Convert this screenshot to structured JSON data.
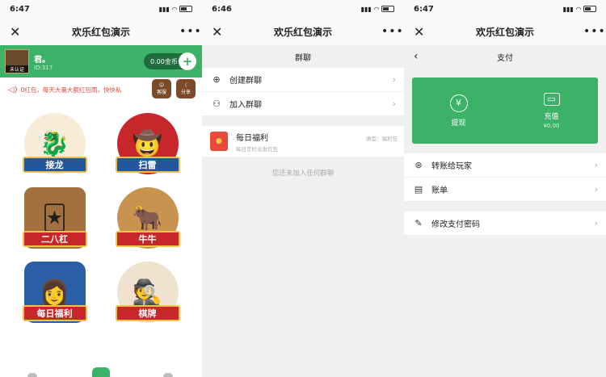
{
  "screen1": {
    "time": "6:47",
    "title": "欢乐红包演示",
    "user": {
      "name": "君。",
      "id": "ID:317",
      "avatar_tag": "未认证"
    },
    "coins": "0.00金币",
    "notice": "0红包，每天大量大额红包雨，快快私",
    "notice_buttons": [
      "客服",
      "分享"
    ],
    "games": [
      "接龙",
      "扫雷",
      "二八杠",
      "牛牛",
      "每日福利",
      "棋牌"
    ]
  },
  "screen2": {
    "time": "6:46",
    "title": "欢乐红包演示",
    "subtitle": "群聊",
    "menu": [
      "创建群聊",
      "加入群聊"
    ],
    "group": {
      "name": "每日福利",
      "desc": "每日定时派发红包",
      "type": "类型：福利包"
    },
    "empty": "您还未加入任何群聊"
  },
  "screen3": {
    "time": "6:47",
    "title": "欢乐红包演示",
    "subtitle": "支付",
    "withdraw": "提现",
    "recharge": "充值",
    "recharge_amount": "¥0.00",
    "menu": [
      "转账给玩家",
      "账单"
    ],
    "menu2": [
      "修改支付密码"
    ]
  },
  "colors": {
    "green": "#3cb269",
    "red": "#e84b3c"
  }
}
